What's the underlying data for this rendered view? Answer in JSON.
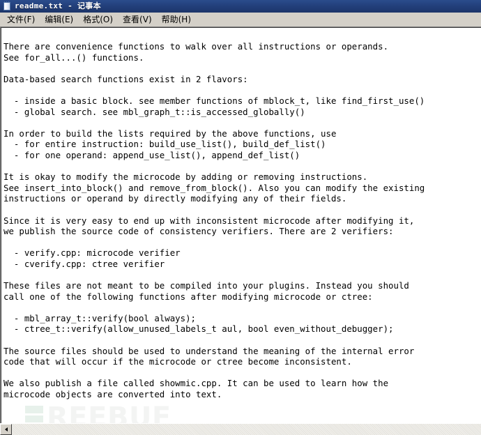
{
  "window": {
    "title": "readme.txt - 记事本",
    "icon": "notepad-icon",
    "titlebar_color": "#23407C",
    "menubar_color": "#D4D0C8",
    "client_color": "#FFFFFF"
  },
  "menu": {
    "items": [
      {
        "label": "文件(F)"
      },
      {
        "label": "编辑(E)"
      },
      {
        "label": "格式(O)"
      },
      {
        "label": "查看(V)"
      },
      {
        "label": "帮助(H)"
      }
    ]
  },
  "document": {
    "filename": "readme.txt",
    "body": "There are convenience functions to walk over all instructions or operands.\nSee for_all...() functions.\n\nData-based search functions exist in 2 flavors:\n\n  - inside a basic block. see member functions of mblock_t, like find_first_use()\n  - global search. see mbl_graph_t::is_accessed_globally()\n\nIn order to build the lists required by the above functions, use\n  - for entire instruction: build_use_list(), build_def_list()\n  - for one operand: append_use_list(), append_def_list()\n\nIt is okay to modify the microcode by adding or removing instructions.\nSee insert_into_block() and remove_from_block(). Also you can modify the existing\ninstructions or operand by directly modifying any of their fields.\n\nSince it is very easy to end up with inconsistent microcode after modifying it,\nwe publish the source code of consistency verifiers. There are 2 verifiers:\n\n  - verify.cpp: microcode verifier\n  - cverify.cpp: ctree verifier\n\nThese files are not meant to be compiled into your plugins. Instead you should\ncall one of the following functions after modifying microcode or ctree:\n\n  - mbl_array_t::verify(bool always);\n  - ctree_t::verify(allow_unused_labels_t aul, bool even_without_debugger);\n\nThe source files should be used to understand the meaning of the internal error\ncode that will occur if the microcode or ctree become inconsistent.\n\nWe also publish a file called showmic.cpp. It can be used to learn how the\nmicrocode objects are converted into text."
  },
  "watermark": {
    "text": "REEBUF",
    "mark_color": "#D9E9DF",
    "text_color": "#ECEEED"
  },
  "scrollbar": {
    "left_arrow": "◄"
  }
}
